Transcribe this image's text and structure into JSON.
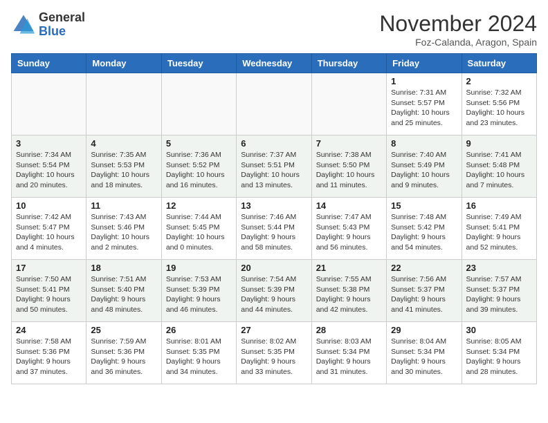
{
  "header": {
    "logo_general": "General",
    "logo_blue": "Blue",
    "month_title": "November 2024",
    "location": "Foz-Calanda, Aragon, Spain"
  },
  "days_of_week": [
    "Sunday",
    "Monday",
    "Tuesday",
    "Wednesday",
    "Thursday",
    "Friday",
    "Saturday"
  ],
  "weeks": [
    {
      "shaded": false,
      "days": [
        {
          "date": "",
          "info": ""
        },
        {
          "date": "",
          "info": ""
        },
        {
          "date": "",
          "info": ""
        },
        {
          "date": "",
          "info": ""
        },
        {
          "date": "",
          "info": ""
        },
        {
          "date": "1",
          "info": "Sunrise: 7:31 AM\nSunset: 5:57 PM\nDaylight: 10 hours and 25 minutes."
        },
        {
          "date": "2",
          "info": "Sunrise: 7:32 AM\nSunset: 5:56 PM\nDaylight: 10 hours and 23 minutes."
        }
      ]
    },
    {
      "shaded": true,
      "days": [
        {
          "date": "3",
          "info": "Sunrise: 7:34 AM\nSunset: 5:54 PM\nDaylight: 10 hours and 20 minutes."
        },
        {
          "date": "4",
          "info": "Sunrise: 7:35 AM\nSunset: 5:53 PM\nDaylight: 10 hours and 18 minutes."
        },
        {
          "date": "5",
          "info": "Sunrise: 7:36 AM\nSunset: 5:52 PM\nDaylight: 10 hours and 16 minutes."
        },
        {
          "date": "6",
          "info": "Sunrise: 7:37 AM\nSunset: 5:51 PM\nDaylight: 10 hours and 13 minutes."
        },
        {
          "date": "7",
          "info": "Sunrise: 7:38 AM\nSunset: 5:50 PM\nDaylight: 10 hours and 11 minutes."
        },
        {
          "date": "8",
          "info": "Sunrise: 7:40 AM\nSunset: 5:49 PM\nDaylight: 10 hours and 9 minutes."
        },
        {
          "date": "9",
          "info": "Sunrise: 7:41 AM\nSunset: 5:48 PM\nDaylight: 10 hours and 7 minutes."
        }
      ]
    },
    {
      "shaded": false,
      "days": [
        {
          "date": "10",
          "info": "Sunrise: 7:42 AM\nSunset: 5:47 PM\nDaylight: 10 hours and 4 minutes."
        },
        {
          "date": "11",
          "info": "Sunrise: 7:43 AM\nSunset: 5:46 PM\nDaylight: 10 hours and 2 minutes."
        },
        {
          "date": "12",
          "info": "Sunrise: 7:44 AM\nSunset: 5:45 PM\nDaylight: 10 hours and 0 minutes."
        },
        {
          "date": "13",
          "info": "Sunrise: 7:46 AM\nSunset: 5:44 PM\nDaylight: 9 hours and 58 minutes."
        },
        {
          "date": "14",
          "info": "Sunrise: 7:47 AM\nSunset: 5:43 PM\nDaylight: 9 hours and 56 minutes."
        },
        {
          "date": "15",
          "info": "Sunrise: 7:48 AM\nSunset: 5:42 PM\nDaylight: 9 hours and 54 minutes."
        },
        {
          "date": "16",
          "info": "Sunrise: 7:49 AM\nSunset: 5:41 PM\nDaylight: 9 hours and 52 minutes."
        }
      ]
    },
    {
      "shaded": true,
      "days": [
        {
          "date": "17",
          "info": "Sunrise: 7:50 AM\nSunset: 5:41 PM\nDaylight: 9 hours and 50 minutes."
        },
        {
          "date": "18",
          "info": "Sunrise: 7:51 AM\nSunset: 5:40 PM\nDaylight: 9 hours and 48 minutes."
        },
        {
          "date": "19",
          "info": "Sunrise: 7:53 AM\nSunset: 5:39 PM\nDaylight: 9 hours and 46 minutes."
        },
        {
          "date": "20",
          "info": "Sunrise: 7:54 AM\nSunset: 5:39 PM\nDaylight: 9 hours and 44 minutes."
        },
        {
          "date": "21",
          "info": "Sunrise: 7:55 AM\nSunset: 5:38 PM\nDaylight: 9 hours and 42 minutes."
        },
        {
          "date": "22",
          "info": "Sunrise: 7:56 AM\nSunset: 5:37 PM\nDaylight: 9 hours and 41 minutes."
        },
        {
          "date": "23",
          "info": "Sunrise: 7:57 AM\nSunset: 5:37 PM\nDaylight: 9 hours and 39 minutes."
        }
      ]
    },
    {
      "shaded": false,
      "days": [
        {
          "date": "24",
          "info": "Sunrise: 7:58 AM\nSunset: 5:36 PM\nDaylight: 9 hours and 37 minutes."
        },
        {
          "date": "25",
          "info": "Sunrise: 7:59 AM\nSunset: 5:36 PM\nDaylight: 9 hours and 36 minutes."
        },
        {
          "date": "26",
          "info": "Sunrise: 8:01 AM\nSunset: 5:35 PM\nDaylight: 9 hours and 34 minutes."
        },
        {
          "date": "27",
          "info": "Sunrise: 8:02 AM\nSunset: 5:35 PM\nDaylight: 9 hours and 33 minutes."
        },
        {
          "date": "28",
          "info": "Sunrise: 8:03 AM\nSunset: 5:34 PM\nDaylight: 9 hours and 31 minutes."
        },
        {
          "date": "29",
          "info": "Sunrise: 8:04 AM\nSunset: 5:34 PM\nDaylight: 9 hours and 30 minutes."
        },
        {
          "date": "30",
          "info": "Sunrise: 8:05 AM\nSunset: 5:34 PM\nDaylight: 9 hours and 28 minutes."
        }
      ]
    }
  ]
}
